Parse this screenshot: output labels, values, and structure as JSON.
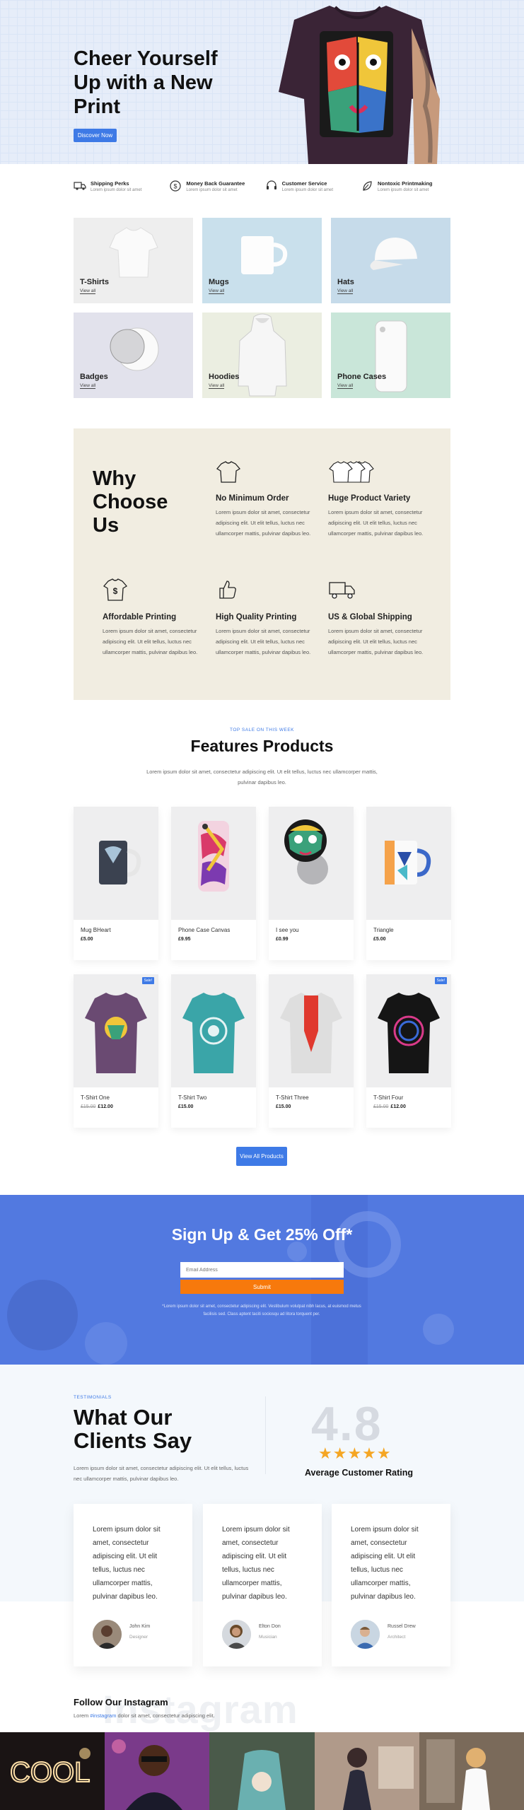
{
  "hero": {
    "title": "Cheer Yourself Up with a New Print",
    "button": "Discover Now"
  },
  "features": [
    {
      "icon": "truck-icon",
      "title": "Shipping Perks",
      "text": "Lorem ipsum dolor sit amet"
    },
    {
      "icon": "dollar-cycle-icon",
      "title": "Money Back Guarantee",
      "text": "Lorem ipsum dolor sit amet"
    },
    {
      "icon": "headset-icon",
      "title": "Customer Service",
      "text": "Lorem ipsum dolor sit amet"
    },
    {
      "icon": "eco-leaf-icon",
      "title": "Nontoxic Printmaking",
      "text": "Lorem ipsum dolor sit amet"
    }
  ],
  "categories": [
    {
      "name": "T-Shirts",
      "link": "View all"
    },
    {
      "name": "Mugs",
      "link": "View all"
    },
    {
      "name": "Hats",
      "link": "View all"
    },
    {
      "name": "Badges",
      "link": "View all"
    },
    {
      "name": "Hoodies",
      "link": "View all"
    },
    {
      "name": "Phone Cases",
      "link": "View all"
    }
  ],
  "why": {
    "title": "Why Choose Us",
    "items": [
      {
        "icon": "tshirt-icon",
        "title": "No Minimum Order",
        "text": "Lorem ipsum dolor sit amet, consectetur adipiscing elit. Ut elit tellus, luctus nec ullamcorper mattis, pulvinar dapibus leo."
      },
      {
        "icon": "tshirt-stack-icon",
        "title": "Huge Product Variety",
        "text": "Lorem ipsum dolor sit amet, consectetur adipiscing elit. Ut elit tellus, luctus nec ullamcorper mattis, pulvinar dapibus leo."
      },
      {
        "icon": "tshirt-dollar-icon",
        "title": "Affordable Printing",
        "text": "Lorem ipsum dolor sit amet, consectetur adipiscing elit. Ut elit tellus, luctus nec ullamcorper mattis, pulvinar dapibus leo."
      },
      {
        "icon": "thumbs-up-icon",
        "title": "High Quality Printing",
        "text": "Lorem ipsum dolor sit amet, consectetur adipiscing elit. Ut elit tellus, luctus nec ullamcorper mattis, pulvinar dapibus leo."
      },
      {
        "icon": "delivery-truck-icon",
        "title": "US & Global Shipping",
        "text": "Lorem ipsum dolor sit amet, consectetur adipiscing elit. Ut elit tellus, luctus nec ullamcorper mattis, pulvinar dapibus leo."
      }
    ]
  },
  "featured": {
    "tag": "TOP SALE ON THIS WEEK",
    "title": "Features Products",
    "desc": "Lorem ipsum dolor sit amet, consectetur adipiscing elit. Ut elit tellus, luctus nec ullamcorper mattis, pulvinar dapibus leo.",
    "sale_label": "Sale!",
    "products": [
      {
        "name": "Mug BHeart",
        "old": "",
        "price": "£5.00"
      },
      {
        "name": "Phone Case Canvas",
        "old": "",
        "price": "£9.95"
      },
      {
        "name": "I see you",
        "old": "",
        "price": "£0.99"
      },
      {
        "name": "Triangle",
        "old": "",
        "price": "£5.00"
      },
      {
        "name": "T-Shirt One",
        "old": "£15.00",
        "price": "£12.00"
      },
      {
        "name": "T-Shirt Two",
        "old": "",
        "price": "£15.00"
      },
      {
        "name": "T-Shirt Three",
        "old": "",
        "price": "£15.00"
      },
      {
        "name": "T-Shirt Four",
        "old": "£15.00",
        "price": "£12.00"
      }
    ],
    "button": "View All Products"
  },
  "signup": {
    "title": "Sign Up & Get 25% Off*",
    "email_placeholder": "Email Address",
    "submit": "Submit",
    "fine": "*Lorem ipsum dolor sit amet, consectetur adipiscing elit. Vestibulum volutpat nibh lacus, at euismod metus facilisis sed. Class aptent taciti sociosqu ad litora torquent per."
  },
  "testimonials": {
    "tag": "TESTIMONIALS",
    "title": "What Our Clients Say",
    "desc": "Lorem ipsum dolor sit amet, consectetur adipiscing elit. Ut elit tellus, luctus nec ullamcorper mattis, pulvinar dapibus leo.",
    "rating": "4.8",
    "stars": "★★★★★",
    "rating_label": "Average Customer Rating",
    "cards": [
      {
        "quote": "Lorem ipsum dolor sit amet, consectetur adipiscing elit. Ut elit tellus, luctus nec ullamcorper mattis, pulvinar dapibus leo.",
        "name": "John Kim",
        "role": "Designer"
      },
      {
        "quote": "Lorem ipsum dolor sit amet, consectetur adipiscing elit. Ut elit tellus, luctus nec ullamcorper mattis, pulvinar dapibus leo.",
        "name": "Elton Don",
        "role": "Musician"
      },
      {
        "quote": "Lorem ipsum dolor sit amet, consectetur adipiscing elit. Ut elit tellus, luctus nec ullamcorper mattis, pulvinar dapibus leo.",
        "name": "Russel Drew",
        "role": "Architect"
      }
    ]
  },
  "instagram": {
    "title": "Follow Our Instagram",
    "desc_pre": "Lorem ",
    "desc_link": "#instagram",
    "desc_post": " dolor sit amet, consectetur adipiscing elit.",
    "watermark": "Instagram"
  },
  "colors": {
    "accent": "#3e7ae6",
    "orange": "#f7790c",
    "why_bg": "#f1ede1",
    "signup_bg": "#5279e0"
  }
}
